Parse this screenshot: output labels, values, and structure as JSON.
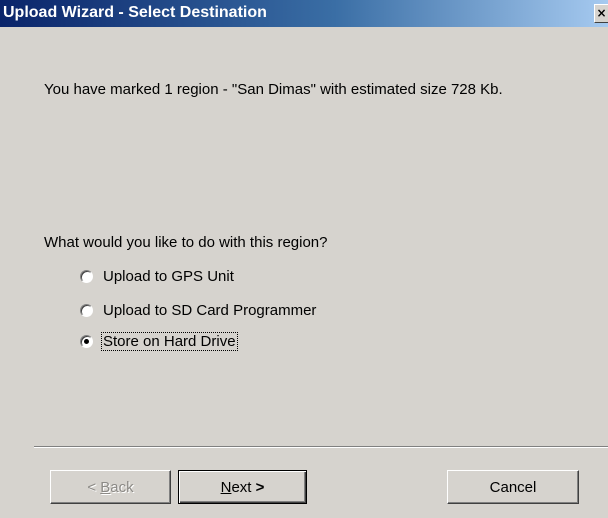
{
  "window": {
    "title": "Upload Wizard - Select Destination",
    "close_glyph": "×"
  },
  "summary_text": "You have marked 1 region - \"San Dimas\" with estimated size 728 Kb.",
  "question_text": "What would you like to do with this region?",
  "options": [
    {
      "label": "Upload to GPS Unit",
      "checked": false
    },
    {
      "label": "Upload to SD Card Programmer",
      "checked": false
    },
    {
      "label": "Store on Hard Drive",
      "checked": true
    }
  ],
  "buttons": {
    "back": {
      "prefix": "< ",
      "mnemonic": "B",
      "rest": "ack",
      "enabled": false
    },
    "next": {
      "mnemonic": "N",
      "rest": "ext ",
      "suffix": ">",
      "enabled": true,
      "default": true
    },
    "cancel": {
      "label": "Cancel",
      "enabled": true
    }
  },
  "colors": {
    "dialog_bg": "#d6d3ce",
    "titlebar_start": "#0a246a",
    "titlebar_end": "#a6caf0"
  }
}
